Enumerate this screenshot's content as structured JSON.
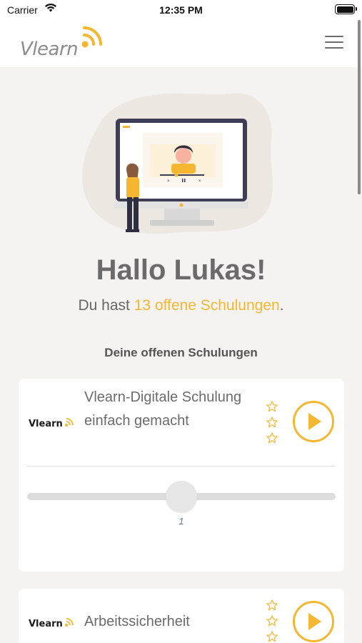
{
  "status_bar": {
    "carrier": "Carrier",
    "time": "12:35 PM"
  },
  "header": {
    "logo_text": "Vlearn",
    "menu_icon": "hamburger-menu-icon"
  },
  "hero": {
    "illustration": "person-watching-video-monitor"
  },
  "greeting": "Hallo Lukas!",
  "summary": {
    "prefix": "Du hast ",
    "highlight": "13 offene Schulungen",
    "suffix": "."
  },
  "section_title": "Deine offenen Schulungen",
  "trainings": [
    {
      "logo_text": "Vlearn",
      "title": "Vlearn-Digitale Schulung einfach gemacht",
      "stars": 3,
      "rating": 0,
      "slider_value": "1",
      "slider_min": 0,
      "slider_max": 2
    },
    {
      "logo_text": "Vlearn",
      "title": "Arbeitssicherheit",
      "stars": 3,
      "rating": 0
    }
  ],
  "colors": {
    "accent": "#f5b731",
    "text": "#6b6b6b",
    "background": "#f4f3f1"
  }
}
